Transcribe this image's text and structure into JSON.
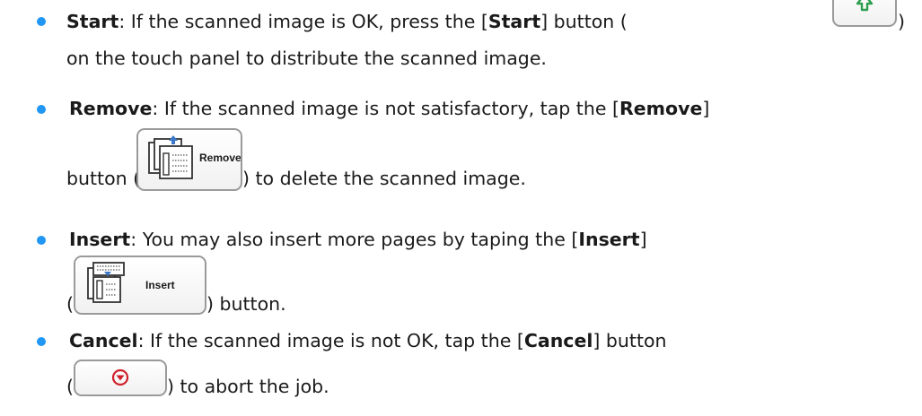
{
  "items": [
    {
      "keyword": "Start",
      "colon": ":",
      "line1_before": " If the scanned image is OK, press the [",
      "bracket_word": "Start",
      "line1_after": "] button (",
      "line2": "on the touch panel to distribute the scanned image.",
      "close_paren": ")",
      "icon": "start-arrow-icon"
    },
    {
      "keyword": "Remove",
      "colon": ":",
      "line1_before": " If the scanned image is not satisfactory, tap the [",
      "bracket_word": "Remove",
      "line1_after": "]",
      "line2_before": "button (",
      "line2_after": ") to delete the scanned image.",
      "button_label": "Remove",
      "icon": "remove-pages-icon"
    },
    {
      "keyword": "Insert",
      "colon": ":",
      "line1_before": " You may also insert more pages by taping the [",
      "bracket_word": "Insert",
      "line1_after": "]",
      "line2_before": "(",
      "line2_after": ") button.",
      "button_label": "Insert",
      "icon": "insert-pages-icon"
    },
    {
      "keyword": "Cancel",
      "colon": ":",
      "line1_before": " If the scanned image is not OK, tap the [",
      "bracket_word": "Cancel",
      "line1_after": "] button",
      "line2_before": "(",
      "line2_after": ") to abort the job.",
      "icon": "cancel-stop-icon"
    }
  ],
  "colors": {
    "bullet": "#2196f3",
    "start_icon": "#2e9e4f",
    "cancel_icon": "#d0202a",
    "remove_icon": "#3a78c8"
  }
}
